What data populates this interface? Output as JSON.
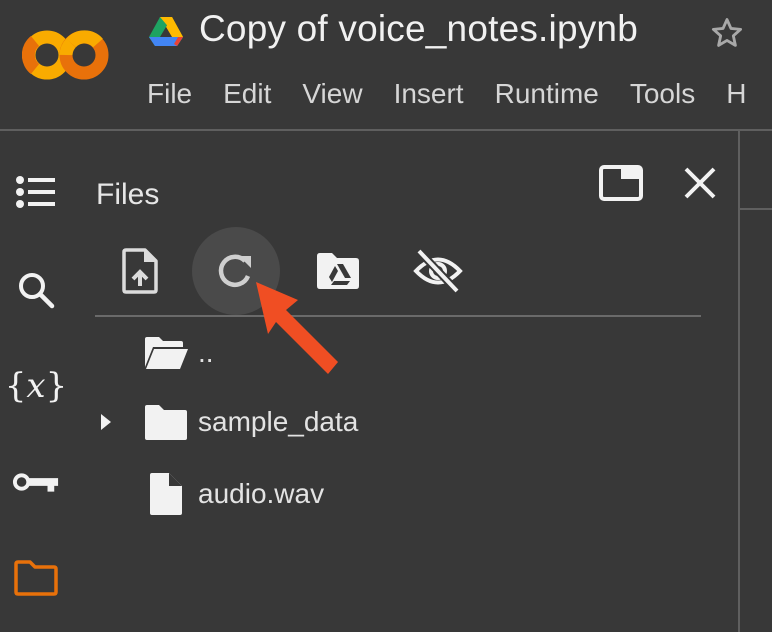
{
  "app": {
    "name": "Google Colab",
    "title": "Copy of voice_notes.ipynb",
    "brand_colors": {
      "orange": "#e8710a",
      "yellow": "#f9ab00"
    }
  },
  "menu": [
    "File",
    "Edit",
    "View",
    "Insert",
    "Runtime",
    "Tools",
    "H"
  ],
  "rail": [
    {
      "icon": "table-of-contents-icon",
      "active": false
    },
    {
      "icon": "search-icon",
      "active": false
    },
    {
      "icon": "variables-icon",
      "active": false
    },
    {
      "icon": "secrets-key-icon",
      "active": false
    },
    {
      "icon": "files-folder-icon",
      "active": true
    }
  ],
  "files_panel": {
    "title": "Files",
    "toolbar": [
      {
        "icon": "upload-file-icon",
        "label": "Upload to session storage"
      },
      {
        "icon": "refresh-icon",
        "label": "Refresh",
        "highlighted": true
      },
      {
        "icon": "mount-drive-icon",
        "label": "Mount Drive"
      },
      {
        "icon": "hide-files-icon",
        "label": "Toggle hidden files"
      }
    ],
    "items": [
      {
        "name": "..",
        "type": "parent-folder",
        "expandable": false
      },
      {
        "name": "sample_data",
        "type": "folder",
        "expandable": true
      },
      {
        "name": "audio.wav",
        "type": "file",
        "expandable": false
      }
    ]
  },
  "annotation": {
    "type": "arrow",
    "target": "refresh-button",
    "color": "#f04e23"
  },
  "colors": {
    "background": "#383838",
    "divider": "#5f5f5f",
    "active_icon": "#e8710a"
  }
}
